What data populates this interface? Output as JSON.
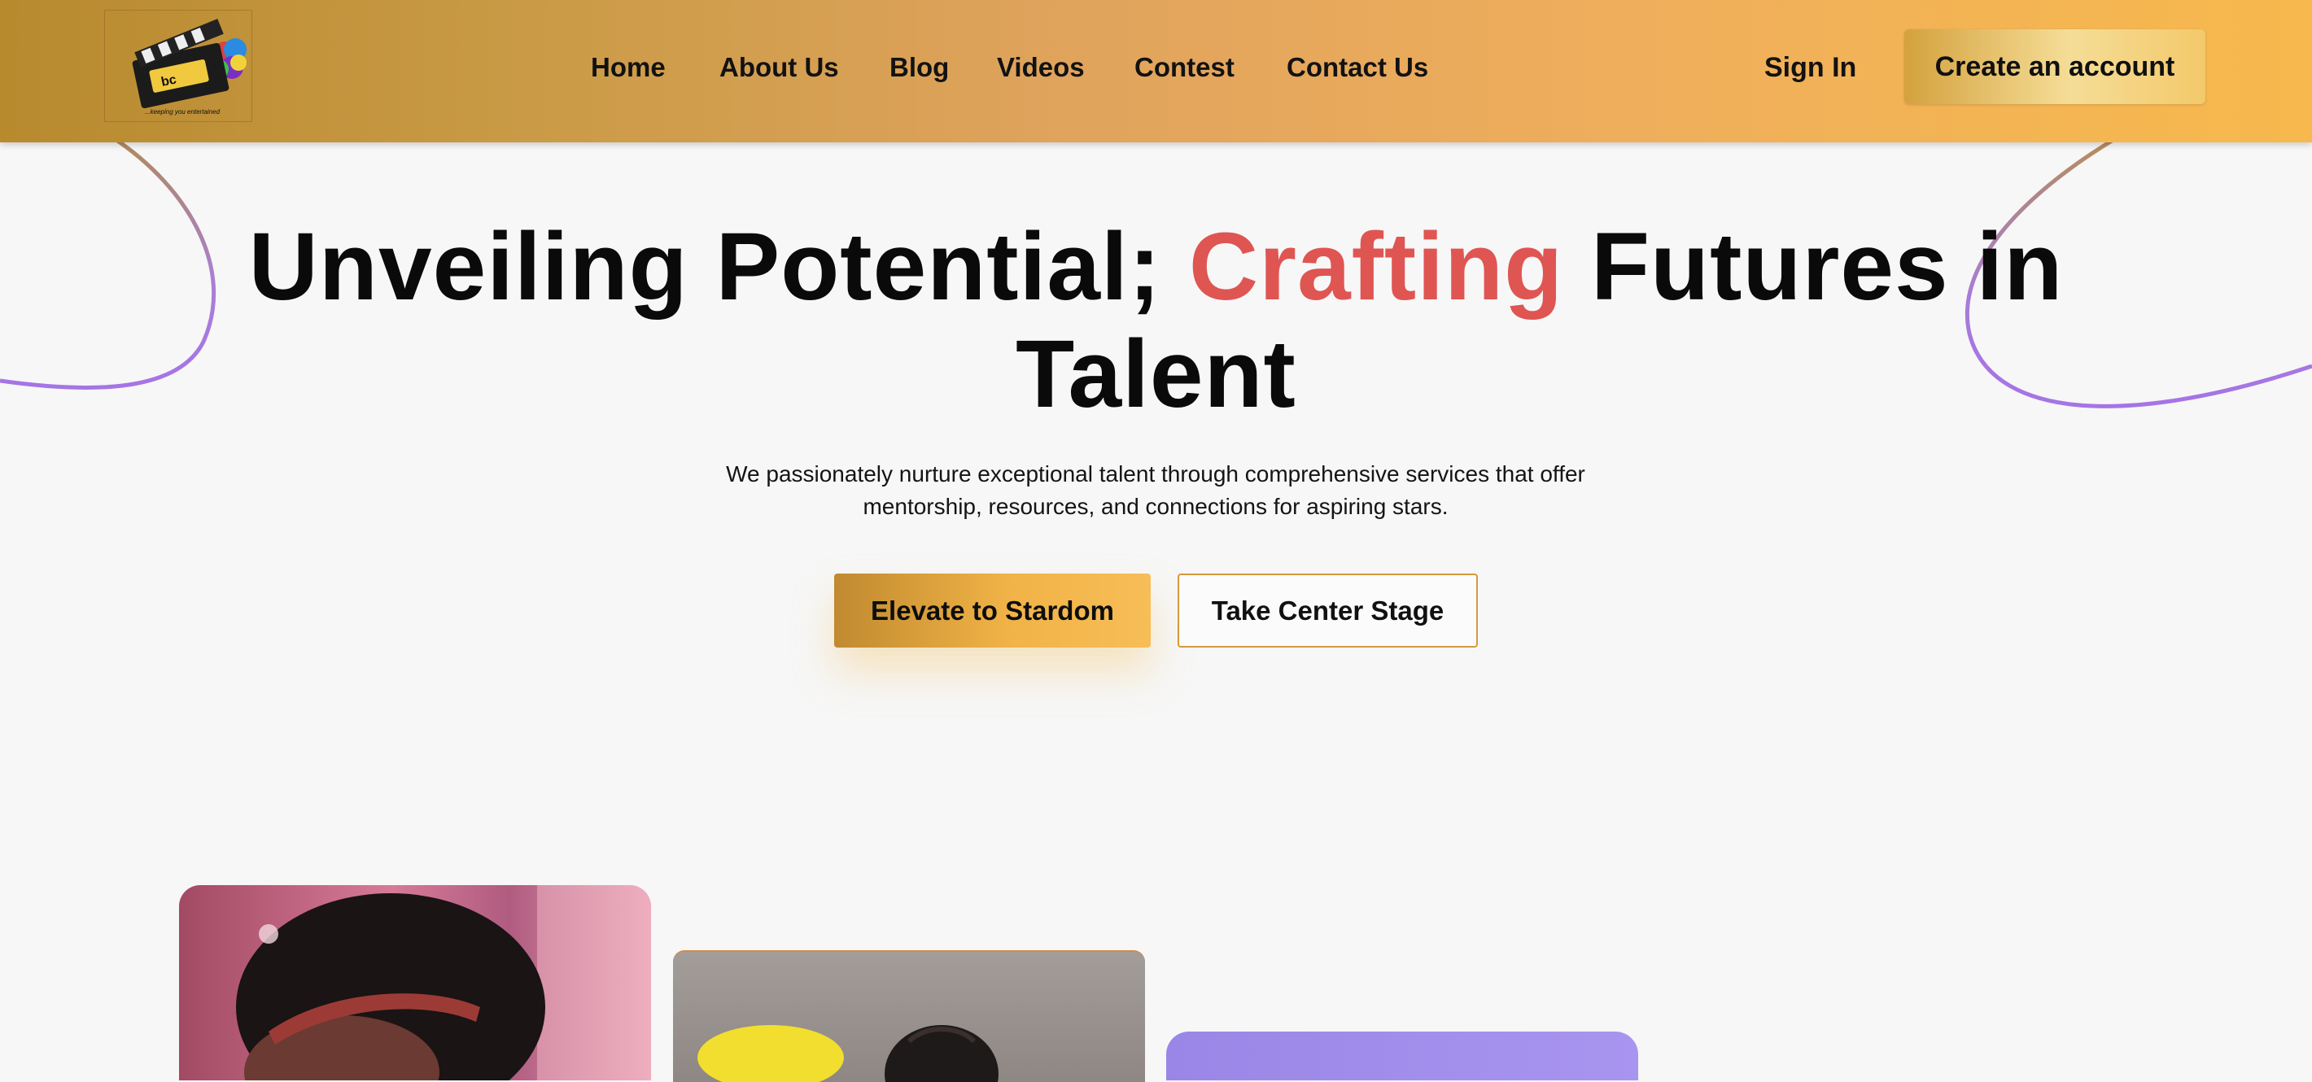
{
  "header": {
    "logo_tag": "...keeping you entertained",
    "nav": [
      "Home",
      "About Us",
      "Blog",
      "Videos",
      "Contest",
      "Contact Us"
    ],
    "sign_in": "Sign In",
    "create_account": "Create an account"
  },
  "hero": {
    "title_part1": "Unveiling Potential; ",
    "title_accent": "Crafting",
    "title_part2": " Futures in Talent",
    "subtitle": "We passionately nurture exceptional talent through comprehensive services that offer mentorship, resources, and connections for aspiring stars.",
    "primary_button": "Elevate to Stardom",
    "secondary_button": "Take Center Stage"
  },
  "colors": {
    "accent_red": "#df5552",
    "header_gold": "#b88a2e",
    "header_orange": "#f7b94d",
    "curve_purple": "#a574e6"
  },
  "icons": {
    "logo": "clapperboard-logo"
  }
}
